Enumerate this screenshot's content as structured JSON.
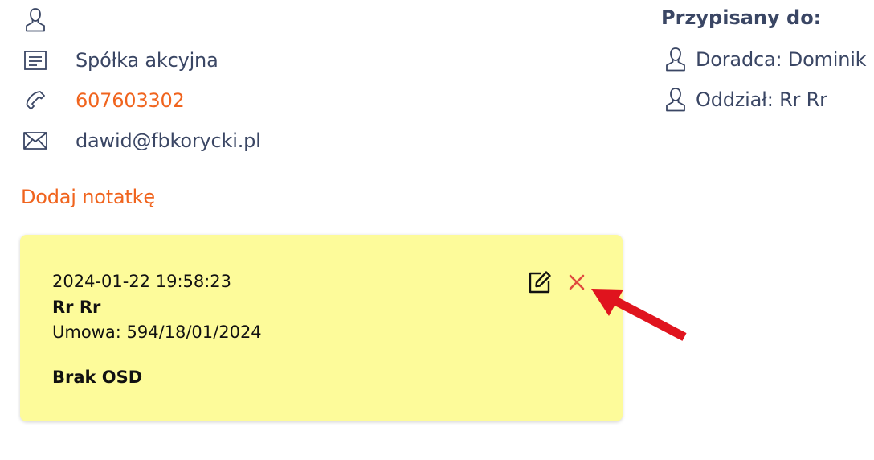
{
  "contact": {
    "name": "",
    "company_type": "Spółka akcyjna",
    "phone": "607603302",
    "email": "dawid@fbkorycki.pl"
  },
  "actions": {
    "add_note_label": "Dodaj notatkę"
  },
  "assigned": {
    "title": "Przypisany do:",
    "advisor": "Doradca: Dominik",
    "branch": "Oddział: Rr Rr"
  },
  "note": {
    "datetime": "2024-01-22 19:58:23",
    "author": "Rr Rr",
    "contract": "Umowa: 594/18/01/2024",
    "body": "Brak OSD",
    "background_color": "#fdfb9a",
    "edit_icon": "edit-icon",
    "delete_icon": "close-icon",
    "delete_color": "#e04a3f"
  },
  "colors": {
    "accent": "#f0641e",
    "text": "#3a4664",
    "annotation_arrow": "#e0141e"
  }
}
